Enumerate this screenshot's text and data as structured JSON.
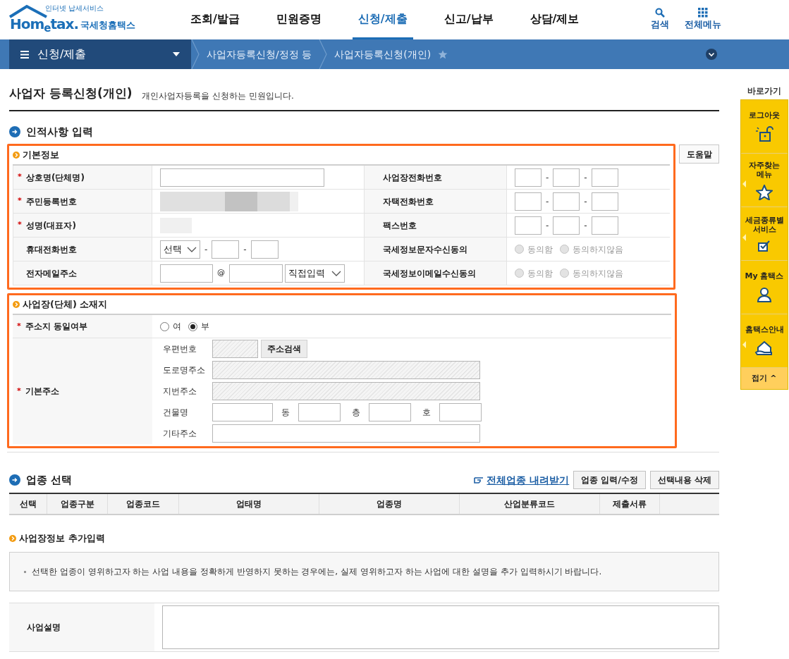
{
  "marks": {
    "required": "*",
    "dash": "-"
  },
  "logo": {
    "tagline": "인터넷 납세서비스",
    "wordmark": "Hom$_{e}$tax.",
    "name": "국세청홈택스"
  },
  "nav": [
    {
      "label": "조회/발급",
      "selected": false
    },
    {
      "label": "민원증명",
      "selected": false
    },
    {
      "label": "신청/제출",
      "selected": true
    },
    {
      "label": "신고/납부",
      "selected": false
    },
    {
      "label": "상담/제보",
      "selected": false
    }
  ],
  "nav_tools": [
    {
      "kind": "search",
      "label": "검색"
    },
    {
      "kind": "menu",
      "label": "전체메뉴"
    }
  ],
  "breadcrumb": {
    "menu": "신청/제출",
    "items": [
      "사업자등록신청/정정 등",
      "사업자등록신청(개인)"
    ]
  },
  "page": {
    "title": "사업자 등록신청(개인)",
    "description": "개인사업자등록을 신청하는 민원입니다."
  },
  "section_personal": {
    "title": "인적사항 입력",
    "box_title": "기본정보",
    "help_button": "도움말",
    "rows": [
      {
        "left": {
          "label": "상호명(단체명)",
          "required": true,
          "kind": "text"
        },
        "right": {
          "label": "사업장전화번호",
          "required": false,
          "kind": "phone3"
        }
      },
      {
        "left": {
          "label": "주민등록번호",
          "required": true,
          "kind": "masked_long"
        },
        "right": {
          "label": "자택전화번호",
          "required": false,
          "kind": "phone3"
        }
      },
      {
        "left": {
          "label": "성명(대표자)",
          "required": true,
          "kind": "masked_short"
        },
        "right": {
          "label": "팩스번호",
          "required": false,
          "kind": "phone3"
        }
      },
      {
        "left": {
          "label": "휴대전화번호",
          "required": false,
          "kind": "mobile",
          "select": "선택"
        },
        "right": {
          "label": "국세정보문자수신동의",
          "required": false,
          "kind": "radio",
          "options": [
            {
              "label": "동의함",
              "selected": false,
              "disabled": true
            },
            {
              "label": "동의하지않음",
              "selected": false,
              "disabled": true
            }
          ]
        }
      },
      {
        "left": {
          "label": "전자메일주소",
          "required": false,
          "kind": "email",
          "at": "@",
          "select": "직접입력"
        },
        "right": {
          "label": "국세정보이메일수신동의",
          "required": false,
          "kind": "radio",
          "options": [
            {
              "label": "동의함",
              "selected": false,
              "disabled": true
            },
            {
              "label": "동의하지않음",
              "selected": false,
              "disabled": true
            }
          ]
        }
      }
    ]
  },
  "section_address": {
    "box_title": "사업장(단체) 소재지",
    "same_label": "주소지 동일여부",
    "same_required": true,
    "same_options": [
      {
        "label": "여",
        "selected": false,
        "disabled": false
      },
      {
        "label": "부",
        "selected": true,
        "disabled": false
      }
    ],
    "address_label": "기본주소",
    "address_required": true,
    "address_rows": [
      {
        "kind": "zip",
        "label": "우편번호",
        "readonly": true,
        "button": "주소검색"
      },
      {
        "kind": "full",
        "label": "도로명주소",
        "readonly": true
      },
      {
        "kind": "full",
        "label": "지번주소",
        "readonly": true
      },
      {
        "kind": "building",
        "label": "건물명",
        "units": [
          "동",
          "층",
          "호"
        ]
      },
      {
        "kind": "full",
        "label": "기타주소",
        "readonly": false
      }
    ]
  },
  "section_industry": {
    "title": "업종 선택",
    "download_link": "전체업종 내려받기",
    "buttons": [
      "업종 입력/수정",
      "선택내용 삭제"
    ],
    "columns": [
      "선택",
      "업종구분",
      "업종코드",
      "업태명",
      "업종명",
      "산업분류코드",
      "제출서류"
    ]
  },
  "section_extra": {
    "title": "사업장정보 추가입력",
    "note": "선택한 업종이 영위하고자 하는 사업 내용을 정확하게 반영하지 못하는 경우에는, 실제 영위하고자 하는 사업에 대한 설명을 추가 입력하시기 바랍니다.",
    "field_label": "사업설명"
  },
  "quick_menu": {
    "title": "바로가기",
    "items": [
      {
        "kind": "logout",
        "label": "로그아웃",
        "arrow": false
      },
      {
        "kind": "favorite",
        "label": "자주찾는 메뉴",
        "arrow": true
      },
      {
        "kind": "tax",
        "label": "세금종류별 서비스",
        "arrow": true
      },
      {
        "kind": "my",
        "label": "My 홈택스",
        "arrow": false
      },
      {
        "kind": "guide",
        "label": "홈택스안내",
        "arrow": true
      }
    ],
    "collapse": "접기 ^"
  }
}
